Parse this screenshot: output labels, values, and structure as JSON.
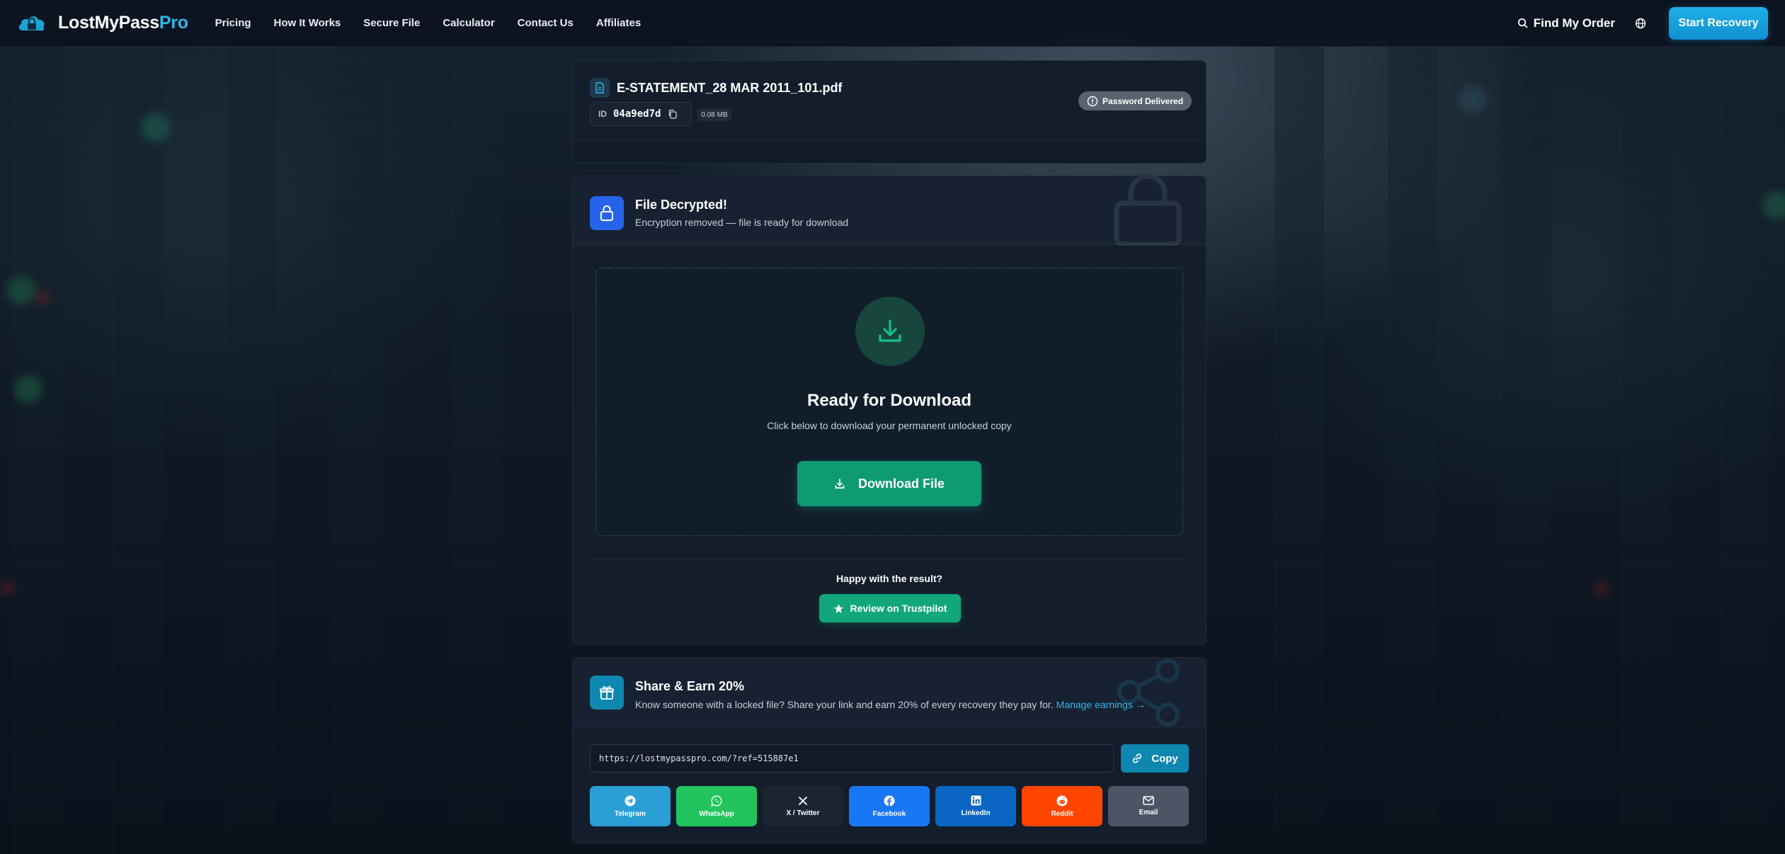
{
  "nav": {
    "brand_main": "LostMyPass",
    "brand_accent": "Pro",
    "links": [
      "Pricing",
      "How It Works",
      "Secure File",
      "Calculator",
      "Contact Us",
      "Affiliates"
    ],
    "find_order": "Find My Order",
    "start_recovery": "Start Recovery"
  },
  "file": {
    "name": "E-STATEMENT_28 MAR 2011_101.pdf",
    "id_label": "ID",
    "id_value": "04a9ed7d",
    "size": "0.08 MB",
    "status": "Password Delivered"
  },
  "decrypted": {
    "title": "File Decrypted!",
    "subtitle": "Encryption removed — file is ready for download",
    "ready_title": "Ready for Download",
    "ready_subtitle": "Click below to download your permanent unlocked copy",
    "download_button": "Download File",
    "happy_text": "Happy with the result?",
    "trustpilot_button": "Review on Trustpilot"
  },
  "share": {
    "title": "Share & Earn 20%",
    "subtitle": "Know someone with a locked file? Share your link and earn 20% of every recovery they pay for.",
    "manage_link": "Manage earnings →",
    "ref_url": "https://lostmypasspro.com/?ref=515887e1",
    "copy_button": "Copy",
    "socials": [
      "Telegram",
      "WhatsApp",
      "X / Twitter",
      "Facebook",
      "LinkedIn",
      "Reddit",
      "Email"
    ]
  },
  "colors": {
    "accent": "#2eb6ea",
    "success": "#0f9b72",
    "primary_blue": "#2563eb",
    "status_gray": "#596370"
  }
}
